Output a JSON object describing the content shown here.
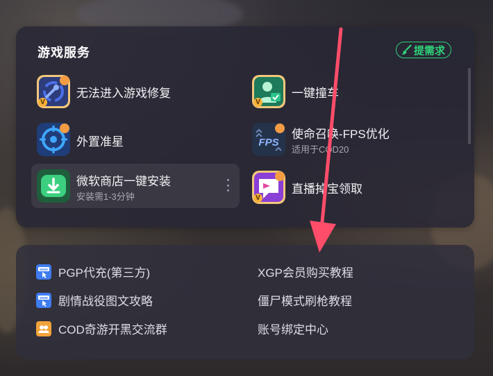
{
  "services": {
    "title": "游戏服务",
    "request_button": "提需求",
    "items": [
      {
        "label": "无法进入游戏修复",
        "sub": "",
        "icon": "wrench-repair-icon"
      },
      {
        "label": "一键撞车",
        "sub": "",
        "icon": "user-match-icon"
      },
      {
        "label": "外置准星",
        "sub": "",
        "icon": "crosshair-icon"
      },
      {
        "label": "使命召唤-FPS优化",
        "sub": "适用于COD20",
        "icon": "fps-icon"
      },
      {
        "label": "微软商店一键安装",
        "sub": "安装需1-3分钟",
        "icon": "download-store-icon"
      },
      {
        "label": "直播掉宝领取",
        "sub": "",
        "icon": "live-drop-icon"
      }
    ]
  },
  "links": {
    "items": [
      {
        "label": "PGP代充(第三方)",
        "icon": "www-icon"
      },
      {
        "label": "XGP会员购买教程",
        "icon": ""
      },
      {
        "label": "剧情战役图文攻略",
        "icon": "www-icon"
      },
      {
        "label": "僵尸模式刷枪教程",
        "icon": ""
      },
      {
        "label": "COD奇游开黑交流群",
        "icon": "group-icon"
      },
      {
        "label": "账号绑定中心",
        "icon": ""
      }
    ]
  },
  "colors": {
    "accent_green": "#2fd27a",
    "arrow_red": "#ff4d6a",
    "badge_orange": "#f39c43"
  }
}
